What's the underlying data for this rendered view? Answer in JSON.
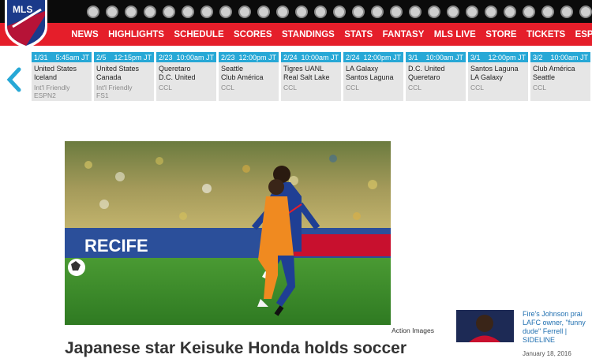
{
  "logo": {
    "text": "MLS"
  },
  "team_logos": [
    "club-crest",
    "club-crest",
    "club-crest",
    "club-crest",
    "club-crest",
    "club-crest",
    "club-crest",
    "club-crest",
    "club-crest",
    "club-crest",
    "club-crest",
    "club-crest",
    "club-crest",
    "club-crest",
    "club-crest",
    "club-crest",
    "club-crest",
    "club-crest",
    "club-crest",
    "club-crest",
    "club-crest",
    "club-crest",
    "club-crest",
    "club-crest",
    "club-crest",
    "club-crest",
    "club-crest",
    "club-crest"
  ],
  "nav": [
    "NEWS",
    "HIGHLIGHTS",
    "SCHEDULE",
    "SCORES",
    "STANDINGS",
    "STATS",
    "FANTASY",
    "MLS LIVE",
    "STORE",
    "TICKETS",
    "ESPAÑOL"
  ],
  "matches": [
    {
      "date": "1/31",
      "time": "5:45am JT",
      "home": "United States",
      "away": "Iceland",
      "comp": "Int'l Friendly",
      "tv": "ESPN2"
    },
    {
      "date": "2/5",
      "time": "12:15pm JT",
      "home": "United States",
      "away": "Canada",
      "comp": "Int'l Friendly",
      "tv": "FS1"
    },
    {
      "date": "2/23",
      "time": "10:00am JT",
      "home": "Queretaro",
      "away": "D.C. United",
      "comp": "CCL",
      "tv": ""
    },
    {
      "date": "2/23",
      "time": "12:00pm JT",
      "home": "Seattle",
      "away": "Club América",
      "comp": "CCL",
      "tv": ""
    },
    {
      "date": "2/24",
      "time": "10:00am JT",
      "home": "Tigres UANL",
      "away": "Real Salt Lake",
      "comp": "CCL",
      "tv": ""
    },
    {
      "date": "2/24",
      "time": "12:00pm JT",
      "home": "LA Galaxy",
      "away": "Santos Laguna",
      "comp": "CCL",
      "tv": ""
    },
    {
      "date": "3/1",
      "time": "10:00am JT",
      "home": "D.C. United",
      "away": "Queretaro",
      "comp": "CCL",
      "tv": ""
    },
    {
      "date": "3/1",
      "time": "12:00pm JT",
      "home": "Santos Laguna",
      "away": "LA Galaxy",
      "comp": "CCL",
      "tv": ""
    },
    {
      "date": "3/2",
      "time": "10:00am JT",
      "home": "Club América",
      "away": "Seattle",
      "comp": "CCL",
      "tv": ""
    }
  ],
  "article": {
    "photo_credit": "Action Images",
    "headline": "Japanese star Keisuke Honda holds soccer"
  },
  "side_story": {
    "title": "Fire's Johnson prai LAFC owner, \"funny dude\" Ferrell | SIDELINE",
    "date": "January 18, 2016"
  },
  "colors": {
    "nav_red": "#e51e2a",
    "topbar": "#0b0b0b",
    "sched_header": "#27a8d6",
    "link_blue": "#1f6fb0"
  }
}
